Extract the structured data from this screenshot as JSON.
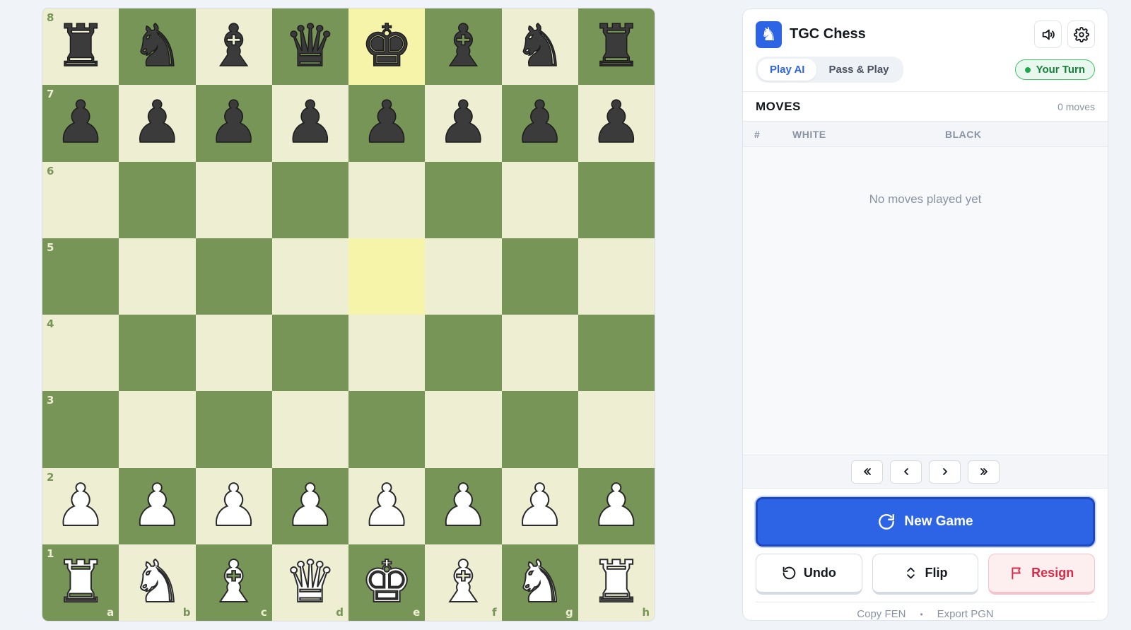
{
  "board": {
    "ranks": [
      "8",
      "7",
      "6",
      "5",
      "4",
      "3",
      "2",
      "1"
    ],
    "files": [
      "a",
      "b",
      "c",
      "d",
      "e",
      "f",
      "g",
      "h"
    ],
    "squares": [
      [
        "b-rook",
        "b-knight",
        "b-bishop",
        "b-queen",
        "b-king",
        "b-bishop",
        "b-knight",
        "b-rook"
      ],
      [
        "b-pawn",
        "b-pawn",
        "b-pawn",
        "b-pawn",
        "b-pawn",
        "b-pawn",
        "b-pawn",
        "b-pawn"
      ],
      [
        "",
        "",
        "",
        "",
        "",
        "",
        "",
        ""
      ],
      [
        "",
        "",
        "",
        "",
        "",
        "",
        "",
        ""
      ],
      [
        "",
        "",
        "",
        "",
        "",
        "",
        "",
        ""
      ],
      [
        "",
        "",
        "",
        "",
        "",
        "",
        "",
        ""
      ],
      [
        "w-pawn",
        "w-pawn",
        "w-pawn",
        "w-pawn",
        "w-pawn",
        "w-pawn",
        "w-pawn",
        "w-pawn"
      ],
      [
        "w-rook",
        "w-knight",
        "w-bishop",
        "w-queen",
        "w-king",
        "w-bishop",
        "w-knight",
        "w-rook"
      ]
    ],
    "highlighted": [
      "e8",
      "e5"
    ],
    "colors": {
      "light": "#eeeed3",
      "dark": "#779556",
      "highlight": "#f5f4a8"
    }
  },
  "header": {
    "title": "TGC Chess",
    "logo_icon": "knight-icon",
    "sound_icon": "speaker-icon",
    "settings_icon": "gear-icon"
  },
  "modes": {
    "play_ai": "Play AI",
    "pass_play": "Pass & Play",
    "active": "play_ai"
  },
  "status": {
    "turn": "Your Turn"
  },
  "moves": {
    "title": "MOVES",
    "count": "0 moves",
    "col_num": "#",
    "col_white": "WHITE",
    "col_black": "BLACK",
    "empty": "No moves played yet"
  },
  "actions": {
    "new_game": "New Game",
    "undo": "Undo",
    "flip": "Flip",
    "resign": "Resign"
  },
  "footer": {
    "copy_fen": "Copy FEN",
    "separator": "•",
    "export_pgn": "Export PGN"
  },
  "accent": "#2d63e5"
}
